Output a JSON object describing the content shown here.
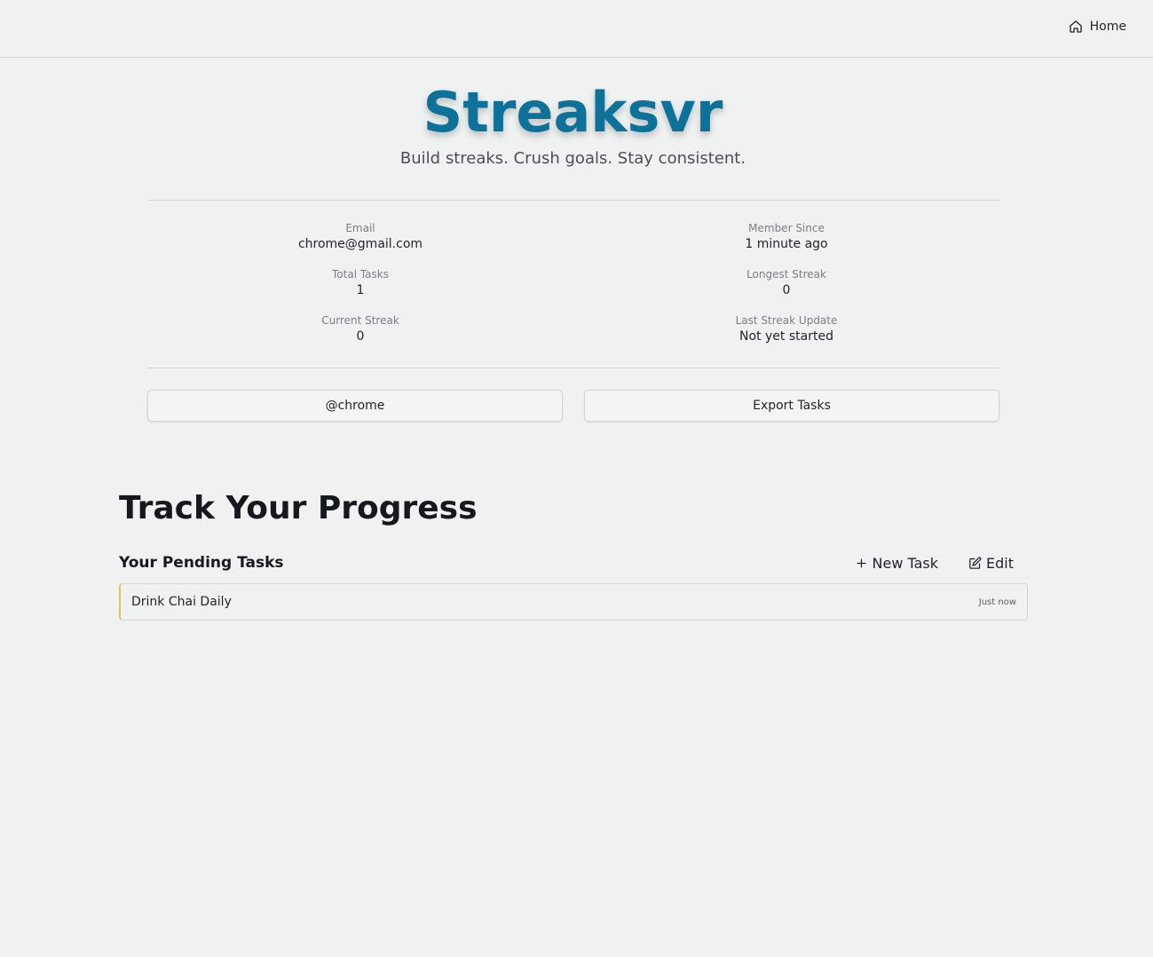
{
  "nav": {
    "home_label": "Home"
  },
  "brand": {
    "title": "Streaksvr",
    "tagline": "Build streaks. Crush goals. Stay consistent.",
    "color": "#0d7299"
  },
  "stats": [
    {
      "label": "Email",
      "value": "chrome@gmail.com"
    },
    {
      "label": "Member Since",
      "value": "1 minute ago"
    },
    {
      "label": "Total Tasks",
      "value": "1"
    },
    {
      "label": "Longest Streak",
      "value": "0"
    },
    {
      "label": "Current Streak",
      "value": "0"
    },
    {
      "label": "Last Streak Update",
      "value": "Not yet started"
    }
  ],
  "actions": {
    "profile_label": "@chrome",
    "export_label": "Export Tasks"
  },
  "progress": {
    "title": "Track Your Progress",
    "pending_title": "Your Pending Tasks",
    "new_task_label": "New Task",
    "edit_label": "Edit"
  },
  "tasks": [
    {
      "name": "Drink Chai Daily",
      "time": "Just now",
      "accent": "#e6c25a"
    }
  ]
}
